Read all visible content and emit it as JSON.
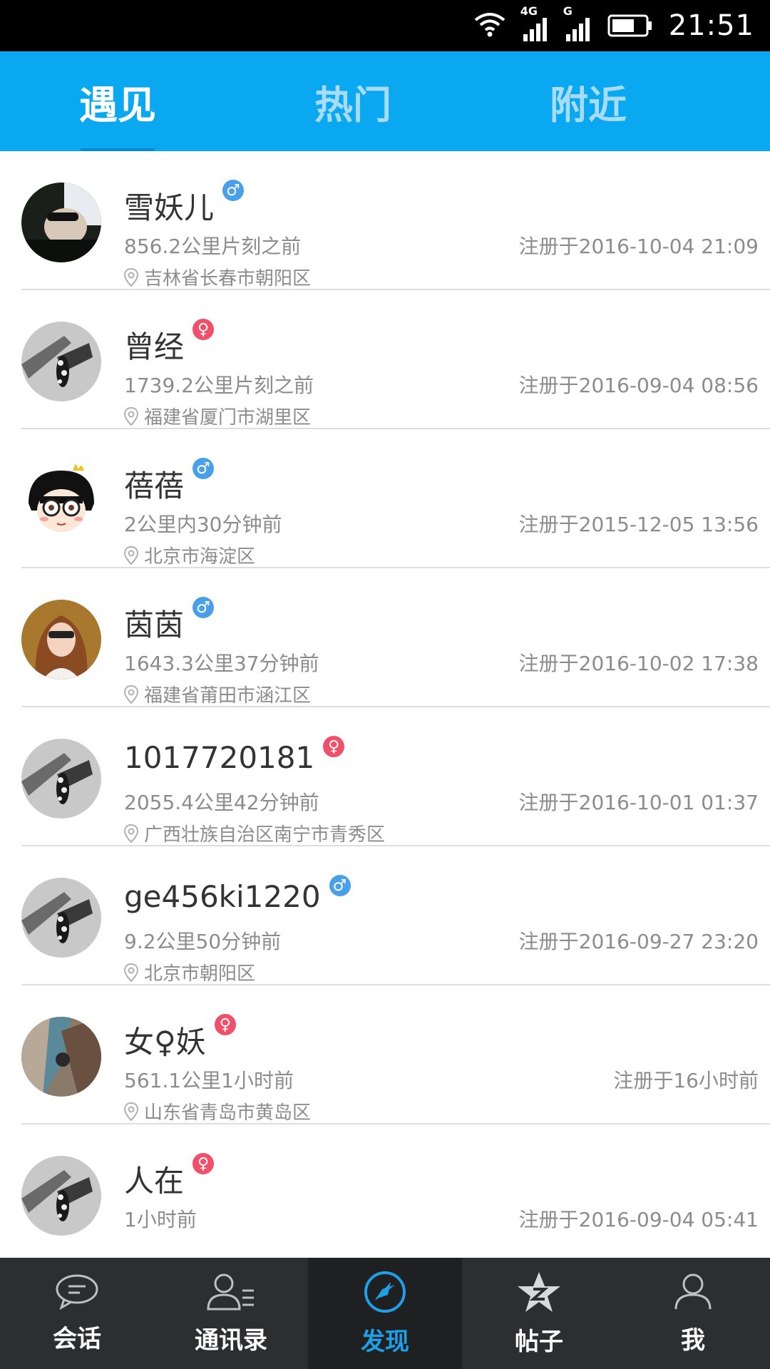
{
  "status_bar": {
    "time": "21:51",
    "network_1": "4G",
    "network_2": "G",
    "icons": [
      "wifi-icon",
      "signal-icon",
      "signal-icon",
      "battery-icon"
    ]
  },
  "top_tabs": [
    {
      "label": "遇见",
      "active": true
    },
    {
      "label": "热门",
      "active": false
    },
    {
      "label": "附近",
      "active": false
    }
  ],
  "users": [
    {
      "name": "雪妖儿",
      "gender": "male",
      "distance": "856.2公里片刻之前",
      "registered": "注册于2016-10-04 21:09",
      "location": "吉林省长春市朝阳区"
    },
    {
      "name": "曾经",
      "gender": "female",
      "distance": "1739.2公里片刻之前",
      "registered": "注册于2016-09-04 08:56",
      "location": "福建省厦门市湖里区"
    },
    {
      "name": "蓓蓓",
      "gender": "male",
      "distance": "2公里内30分钟前",
      "registered": "注册于2015-12-05 13:56",
      "location": "北京市海淀区"
    },
    {
      "name": "茵茵",
      "gender": "male",
      "distance": "1643.3公里37分钟前",
      "registered": "注册于2016-10-02 17:38",
      "location": "福建省莆田市涵江区"
    },
    {
      "name": "1017720181",
      "gender": "female",
      "distance": "2055.4公里42分钟前",
      "registered": "注册于2016-10-01 01:37",
      "location": "广西壮族自治区南宁市青秀区"
    },
    {
      "name": "ge456ki1220",
      "gender": "male",
      "distance": "9.2公里50分钟前",
      "registered": "注册于2016-09-27 23:20",
      "location": "北京市朝阳区"
    },
    {
      "name": "女♀妖",
      "gender": "female",
      "distance": "561.1公里1小时前",
      "registered": "注册于16小时前",
      "location": "山东省青岛市黄岛区"
    },
    {
      "name": "人在",
      "gender": "female",
      "distance": "1小时前",
      "registered": "注册于2016-09-04 05:41",
      "location": ""
    }
  ],
  "bottom_nav": [
    {
      "label": "会话",
      "icon": "chat-icon",
      "active": false
    },
    {
      "label": "通讯录",
      "icon": "contacts-icon",
      "active": false
    },
    {
      "label": "发现",
      "icon": "compass-icon",
      "active": true
    },
    {
      "label": "帖子",
      "icon": "star-icon",
      "active": false
    },
    {
      "label": "我",
      "icon": "profile-icon",
      "active": false
    }
  ],
  "colors": {
    "accent": "#0aa8f0",
    "male": "#4aa0e8",
    "female": "#f2506a",
    "nav_bg": "#2d2e30",
    "nav_active": "#1ea0e8"
  }
}
